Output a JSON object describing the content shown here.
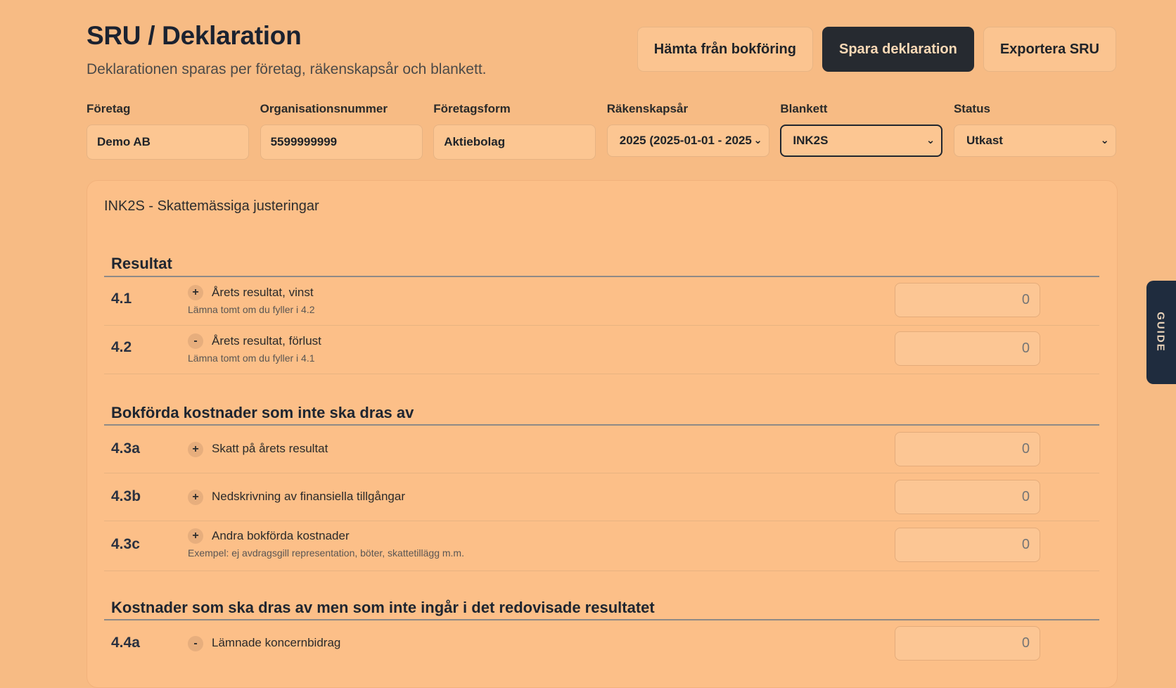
{
  "header": {
    "title": "SRU / Deklaration",
    "subtitle": "Deklarationen sparas per företag, räkenskapsår och blankett.",
    "actions": {
      "fetch_label": "Hämta från bokföring",
      "save_label": "Spara deklaration",
      "export_label": "Exportera SRU"
    }
  },
  "fields": {
    "company": {
      "label": "Företag",
      "value": "Demo AB"
    },
    "org_number": {
      "label": "Organisationsnummer",
      "value": "5599999999"
    },
    "company_form": {
      "label": "Företagsform",
      "value": "Aktiebolag"
    },
    "fiscal_year": {
      "label": "Räkenskapsår",
      "selected": "2025 (2025-01-01 - 2025"
    },
    "form": {
      "label": "Blankett",
      "selected": "INK2S"
    },
    "status": {
      "label": "Status",
      "selected": "Utkast"
    }
  },
  "panel": {
    "title": "INK2S - Skattemässiga justeringar",
    "sections": [
      {
        "title": "Resultat",
        "rows": [
          {
            "code": "4.1",
            "sign": "+",
            "label": "Årets resultat, vinst",
            "hint": "Lämna tomt om du fyller i 4.2",
            "value": "0"
          },
          {
            "code": "4.2",
            "sign": "-",
            "label": "Årets resultat, förlust",
            "hint": "Lämna tomt om du fyller i 4.1",
            "value": "0"
          }
        ]
      },
      {
        "title": "Bokförda kostnader som inte ska dras av",
        "rows": [
          {
            "code": "4.3a",
            "sign": "+",
            "label": "Skatt på årets resultat",
            "value": "0"
          },
          {
            "code": "4.3b",
            "sign": "+",
            "label": "Nedskrivning av finansiella tillgångar",
            "value": "0"
          },
          {
            "code": "4.3c",
            "sign": "+",
            "label": "Andra bokförda kostnader",
            "hint": "Exempel: ej avdragsgill representation, böter, skattetillägg m.m.",
            "value": "0"
          }
        ]
      },
      {
        "title": "Kostnader som ska dras av men som inte ingår i det redovisade resultatet",
        "rows": [
          {
            "code": "4.4a",
            "sign": "-",
            "label": "Lämnade koncernbidrag",
            "value": "0"
          }
        ]
      }
    ]
  },
  "guide_tab": {
    "label": "GUIDE"
  }
}
